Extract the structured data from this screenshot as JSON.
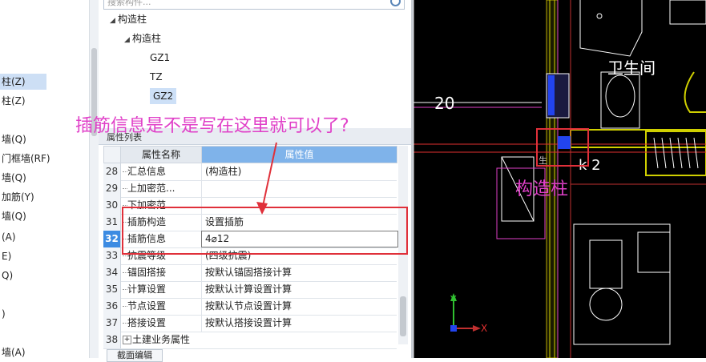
{
  "left_list": [
    {
      "label": "柱(Z)",
      "selected": true
    },
    {
      "label": "柱(Z)",
      "selected": false
    },
    {
      "label": "墙(Q)",
      "selected": false
    },
    {
      "label": "门框墙(RF)",
      "selected": false
    },
    {
      "label": "墙(Q)",
      "selected": false
    },
    {
      "label": "加筋(Y)",
      "selected": false
    },
    {
      "label": "墙(Q)",
      "selected": false
    },
    {
      "label": "(A)",
      "selected": false
    },
    {
      "label": "E)",
      "selected": false
    },
    {
      "label": "Q)",
      "selected": false
    },
    {
      "label": ")",
      "selected": false
    },
    {
      "label": "墙(A)",
      "selected": false
    }
  ],
  "search": {
    "placeholder": "搜索构件..."
  },
  "tree": [
    {
      "label": "构造柱",
      "level": 0,
      "arrow": "◢",
      "selected": false
    },
    {
      "label": "构造柱",
      "level": 1,
      "arrow": "◢",
      "selected": false
    },
    {
      "label": "GZ1",
      "level": 2,
      "arrow": "",
      "selected": false
    },
    {
      "label": "TZ",
      "level": 2,
      "arrow": "",
      "selected": false
    },
    {
      "label": "GZ2",
      "level": 2,
      "arrow": "",
      "selected": true
    }
  ],
  "properties": {
    "panel_title": "属性列表",
    "col_name": "属性名称",
    "col_value": "属性值",
    "rows": [
      {
        "num": "28",
        "name": "汇总信息",
        "value": "(构造柱)"
      },
      {
        "num": "29",
        "name": "上加密范...",
        "value": ""
      },
      {
        "num": "30",
        "name": "下加密范...",
        "value": ""
      },
      {
        "num": "31",
        "name": "插筋构造",
        "value": "设置插筋"
      },
      {
        "num": "32",
        "name": "插筋信息",
        "value": "4⌀12",
        "active": true
      },
      {
        "num": "33",
        "name": "抗震等级",
        "value": "(四级抗震)"
      },
      {
        "num": "34",
        "name": "锚固搭接",
        "value": "按默认锚固搭接计算"
      },
      {
        "num": "35",
        "name": "计算设置",
        "value": "按默认计算设置计算"
      },
      {
        "num": "36",
        "name": "节点设置",
        "value": "按默认节点设置计算"
      },
      {
        "num": "37",
        "name": "搭接设置",
        "value": "按默认搭接设置计算"
      },
      {
        "num": "38",
        "name": "土建业务属性",
        "value": "",
        "expandable": true
      }
    ],
    "section_button": "截面编辑"
  },
  "cad": {
    "room_label": "卫生间",
    "dim_label": "20",
    "axis_x": "X",
    "axis_y": "Y",
    "col_text": "k 2",
    "col_tag": "生"
  },
  "annotations": {
    "question": "插筋信息是不是写在这里就可以了?",
    "column_label": "构造柱"
  },
  "colors": {
    "annotation": "#e040c8",
    "highlight": "#e0303a",
    "selected_row": "#3c8be2"
  }
}
